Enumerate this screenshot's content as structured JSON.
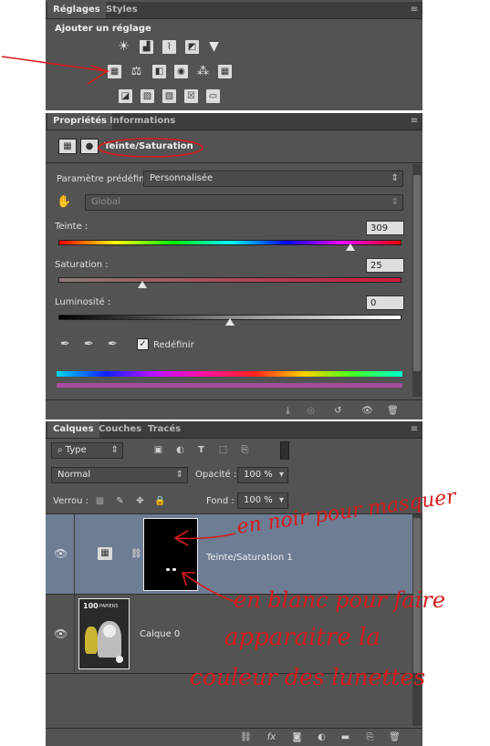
{
  "reglages": {
    "tabs": [
      "Réglages",
      "Styles"
    ],
    "title": "Ajouter un réglage",
    "row1_icons": [
      "brightness-icon",
      "levels-icon",
      "curves-icon",
      "exposure-icon",
      "vibrance-icon"
    ],
    "row2_icons": [
      "hue-saturation-icon",
      "color-balance-icon",
      "black-white-icon",
      "photo-filter-icon",
      "channel-mixer-icon",
      "color-lookup-icon"
    ],
    "row3_icons": [
      "invert-icon",
      "posterize-icon",
      "threshold-icon",
      "selective-color-icon",
      "gradient-map-icon"
    ]
  },
  "properties": {
    "tabs": [
      "Propriétés",
      "Informations"
    ],
    "layer_title": "Teinte/Saturation",
    "preset_label": "Paramètre prédéfini :",
    "preset_value": "Personnalisée",
    "channel_value": "Global",
    "hue_label": "Teinte :",
    "hue_value": "309",
    "saturation_label": "Saturation :",
    "saturation_value": "25",
    "lightness_label": "Luminosité :",
    "lightness_value": "0",
    "colorize_label": "Redéfinir",
    "colorize_checked": true,
    "hue_level": 309,
    "saturation_level": 25,
    "lightness_level": 0
  },
  "layers": {
    "tabs": [
      "Calques",
      "Couches",
      "Tracés"
    ],
    "filter_label": "Type",
    "blend_mode": "Normal",
    "opacity_label": "Opacité :",
    "opacity_value": "100 %",
    "lock_label": "Verrou :",
    "fill_label": "Fond :",
    "fill_value": "100 %",
    "items": [
      {
        "name": "Teinte/Saturation 1"
      },
      {
        "name": "Calque 0"
      }
    ],
    "thumb_caption_line1": "100",
    "thumb_caption_line2": "PAPIERS"
  },
  "annotations": {
    "note_black": "en noir pour masquer",
    "note_white_1": "en blanc pour faire",
    "note_white_2": "apparaitre la",
    "note_white_3": "couleur des lunettes",
    "colors": {
      "annotation": "#d61b1b",
      "panel": "#535353",
      "selected_layer": "#6d7d94"
    }
  }
}
